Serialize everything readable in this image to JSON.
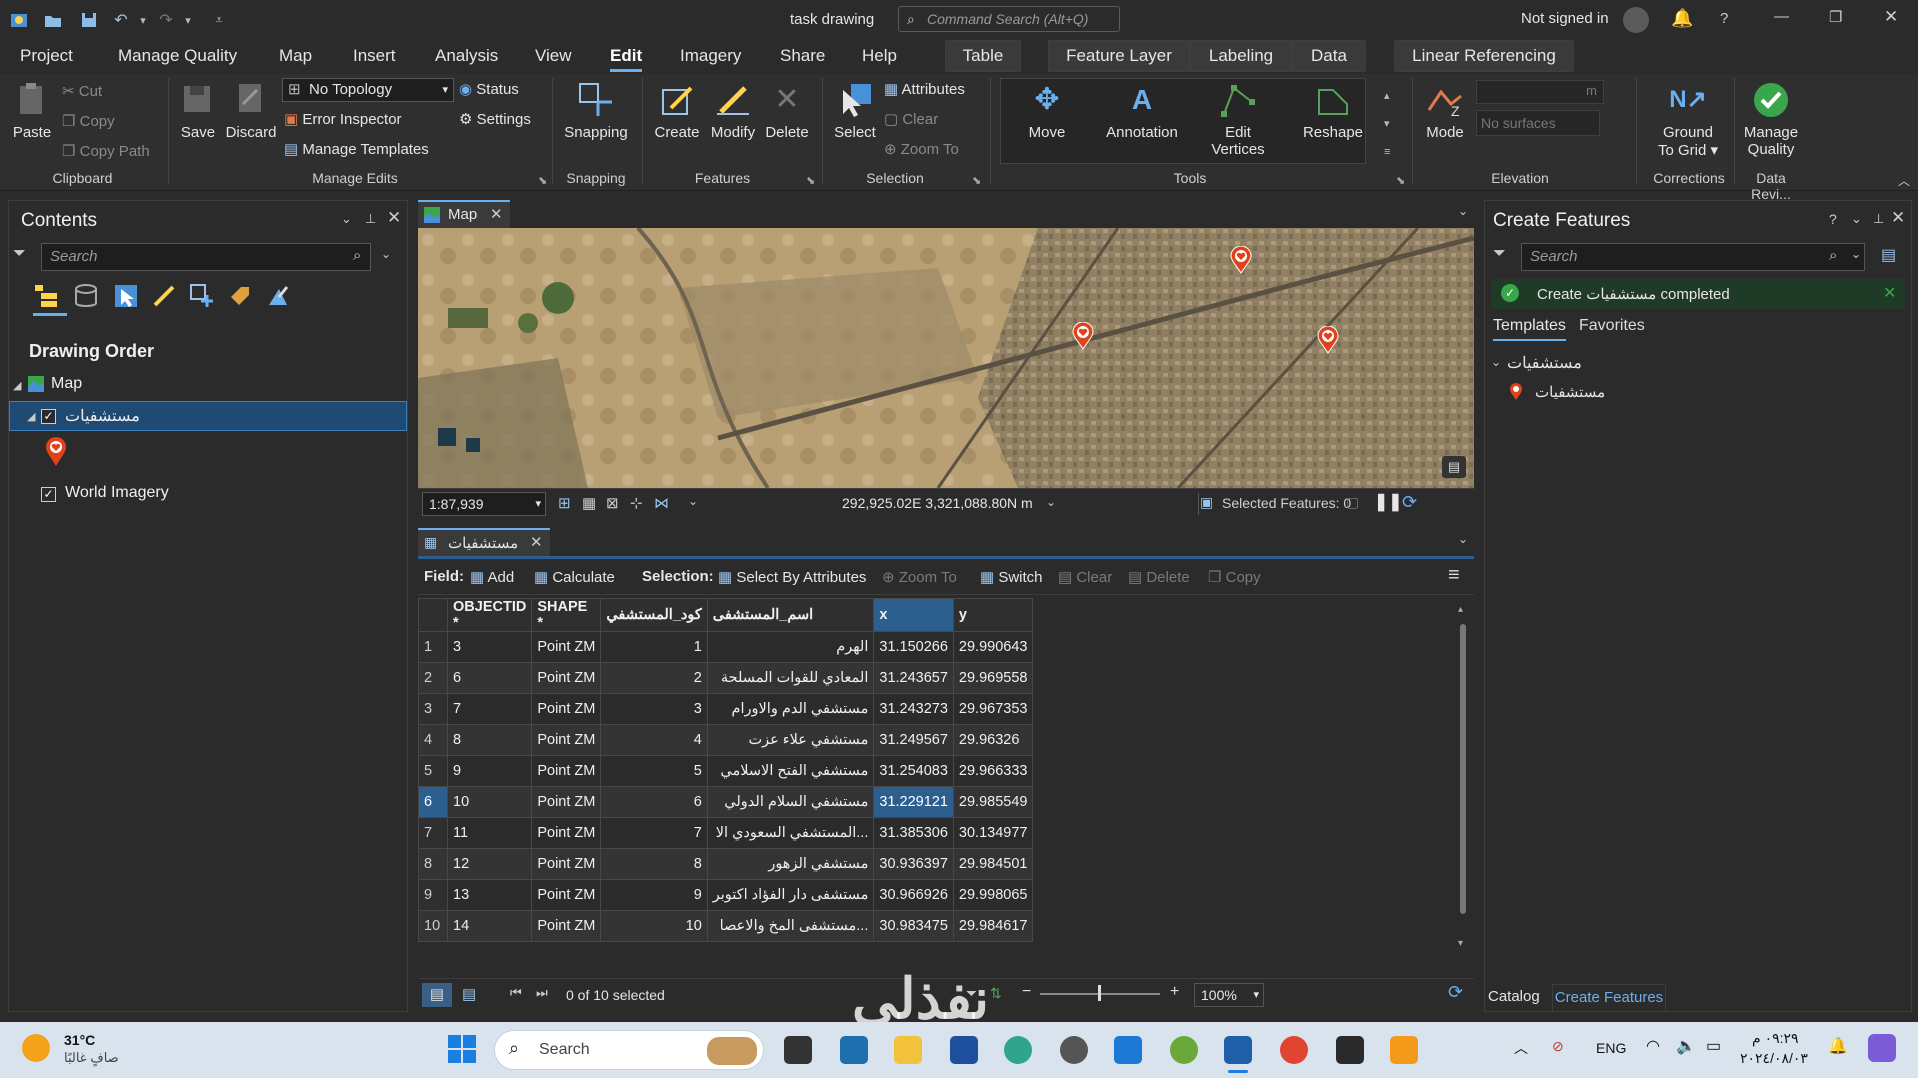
{
  "titlebar": {
    "title": "task drawing",
    "command_search_placeholder": "Command Search (Alt+Q)",
    "signin": "Not signed in"
  },
  "menu": {
    "items": [
      "Project",
      "Manage Quality",
      "Map",
      "Insert",
      "Analysis",
      "View",
      "Edit",
      "Imagery",
      "Share",
      "Help"
    ],
    "contextual_tabs": [
      "Table",
      "Feature Layer",
      "Labeling",
      "Data",
      "Linear Referencing"
    ]
  },
  "ribbon": {
    "clipboard": {
      "paste": "Paste",
      "cut": "Cut",
      "copy": "Copy",
      "copy_path": "Copy Path",
      "group": "Clipboard"
    },
    "manage_edits": {
      "save": "Save",
      "discard": "Discard",
      "topology": "No Topology",
      "status": "Status",
      "error_inspector": "Error Inspector",
      "settings": "Settings",
      "manage_templates": "Manage Templates",
      "group": "Manage Edits"
    },
    "snapping": {
      "label": "Snapping",
      "group": "Snapping"
    },
    "features": {
      "create": "Create",
      "modify": "Modify",
      "delete": "Delete",
      "group": "Features"
    },
    "selection": {
      "select": "Select",
      "attributes": "Attributes",
      "clear": "Clear",
      "zoom_to": "Zoom To",
      "group": "Selection"
    },
    "tools": {
      "move": "Move",
      "annotation": "Annotation",
      "edit_vertices_1": "Edit",
      "edit_vertices_2": "Vertices",
      "reshape": "Reshape",
      "group": "Tools"
    },
    "elevation": {
      "mode": "Mode",
      "surfaces": "No surfaces",
      "unit": "m",
      "group": "Elevation"
    },
    "corrections": {
      "ground_1": "Ground",
      "ground_2": "To Grid",
      "group": "Corrections"
    },
    "data_reviewer": {
      "manage_1": "Manage",
      "manage_2": "Quality",
      "group": "Data Revi..."
    }
  },
  "contents": {
    "title": "Contents",
    "search_placeholder": "Search",
    "drawing_order": "Drawing Order",
    "map_label": "Map",
    "layer1": "مستشفيات",
    "layer2": "World Imagery"
  },
  "map": {
    "tab": "Map",
    "scale": "1:87,939",
    "coords": "292,925.02E 3,321,088.80N m",
    "selected_features": "Selected Features: 0"
  },
  "table_view": {
    "tab": "مستشفيات",
    "field_label": "Field:",
    "add": "Add",
    "calculate": "Calculate",
    "selection_label": "Selection:",
    "select_by_attributes": "Select By Attributes",
    "zoom_to": "Zoom To",
    "switch": "Switch",
    "clear": "Clear",
    "delete": "Delete",
    "copy": "Copy",
    "columns": [
      "OBJECTID *",
      "SHAPE *",
      "كود_المستشفي",
      "اسم_المستشفى",
      "x",
      "y"
    ],
    "rows": [
      [
        "1",
        "3",
        "Point ZM",
        "1",
        "الهرم",
        "31.150266",
        "29.990643"
      ],
      [
        "2",
        "6",
        "Point ZM",
        "2",
        "المعادي للقوات المسلحة",
        "31.243657",
        "29.969558"
      ],
      [
        "3",
        "7",
        "Point ZM",
        "3",
        "مستشفي الدم والاورام",
        "31.243273",
        "29.967353"
      ],
      [
        "4",
        "8",
        "Point ZM",
        "4",
        "مستشفي علاء عزت",
        "31.249567",
        "29.96326"
      ],
      [
        "5",
        "9",
        "Point ZM",
        "5",
        "مستشفي الفتح الاسلامي",
        "31.254083",
        "29.966333"
      ],
      [
        "6",
        "10",
        "Point ZM",
        "6",
        "مستشفي السلام الدولي",
        "31.229121",
        "29.985549"
      ],
      [
        "7",
        "11",
        "Point ZM",
        "7",
        "...المستشفي السعودي الا",
        "31.385306",
        "30.134977"
      ],
      [
        "8",
        "12",
        "Point ZM",
        "8",
        "مستشفي الزهور",
        "30.936397",
        "29.984501"
      ],
      [
        "9",
        "13",
        "Point ZM",
        "9",
        "مستشفى دار الفؤاد اكتوبر",
        "30.966926",
        "29.998065"
      ],
      [
        "10",
        "14",
        "Point ZM",
        "10",
        "...مستشفى المخ والاعصا",
        "30.983475",
        "29.984617"
      ]
    ],
    "footer_selected": "0 of 10 selected",
    "zoom_pct": "100%",
    "watermark": "نفذلي"
  },
  "create_features": {
    "title": "Create Features",
    "search_placeholder": "Search",
    "message": "Create مستشفيات completed",
    "tab_templates": "Templates",
    "tab_favorites": "Favorites",
    "group": "مستشفيات",
    "item": "مستشفيات"
  },
  "bottom_tabs": {
    "catalog": "Catalog",
    "create_features": "Create Features"
  },
  "taskbar": {
    "weather_temp": "31°C",
    "weather_desc": "صافٍ غالبًا",
    "search": "Search",
    "lang": "ENG",
    "time": "٠٩:٢٩ م",
    "date": "٢٠٢٤/٠٨/٠٣"
  },
  "colors": {
    "accent": "#6ab0f0",
    "selection": "#2d5f8e",
    "pin": "#e0421c",
    "success": "#3aa64c"
  }
}
